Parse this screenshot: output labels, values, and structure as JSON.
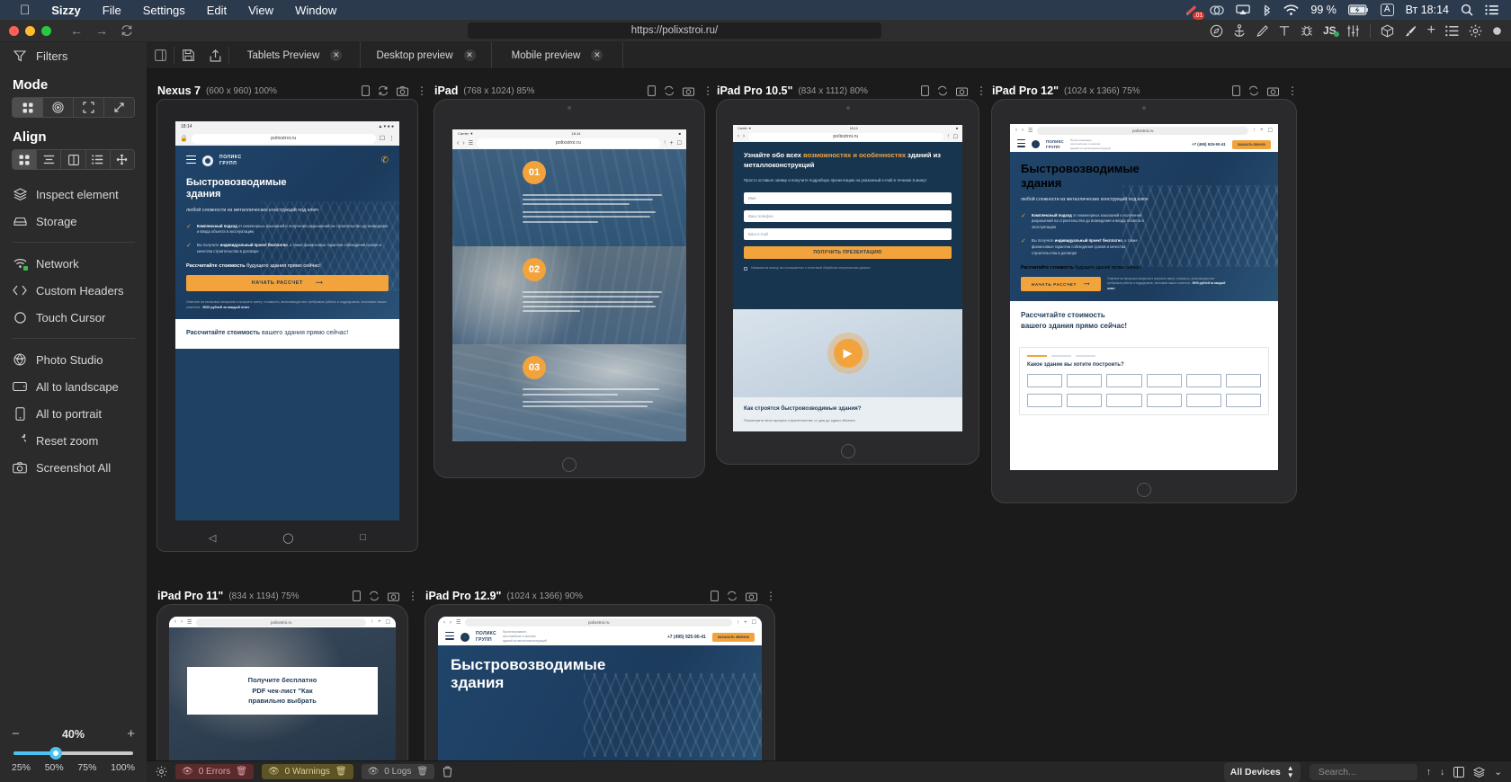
{
  "menubar": {
    "apple_icon": "apple-icon",
    "items": [
      {
        "label": "Sizzy",
        "bold": true
      },
      {
        "label": "File",
        "bold": false
      },
      {
        "label": "Settings",
        "bold": false
      },
      {
        "label": "Edit",
        "bold": false
      },
      {
        "label": "View",
        "bold": false
      },
      {
        "label": "Window",
        "bold": false
      }
    ],
    "tray": {
      "badge_count": ".01",
      "battery_percent": "99 %",
      "input_source": "A",
      "clock": "Вт 18:14",
      "icons": [
        "kite-icon",
        "creative-cloud-icon",
        "airplay-icon",
        "bluetooth-icon",
        "wifi-icon",
        "battery-charging-icon",
        "search-icon",
        "control-center-icon"
      ]
    }
  },
  "chrome": {
    "url": "https://polixstroi.ru/",
    "nav": {
      "back": "back-icon",
      "forward": "forward-icon",
      "reload": "reload-icon"
    },
    "right_icons": [
      "compass-icon",
      "anchor-icon",
      "pencil-icon",
      "text-icon",
      "bug-icon",
      "js-icon",
      "sliders-icon",
      "box-icon",
      "brush-icon",
      "plus-icon",
      "list-icon",
      "gear-icon",
      "dot-icon"
    ]
  },
  "sidebar": {
    "filters_label": "Filters",
    "mode_label": "Mode",
    "align_label": "Align",
    "mode_buttons": [
      {
        "name": "grid-mode",
        "glyph": "▞",
        "active": true
      },
      {
        "name": "focus-mode",
        "glyph": "◎",
        "active": false
      },
      {
        "name": "crop-mode",
        "glyph": "⛶",
        "active": false
      },
      {
        "name": "fullscreen-mode",
        "glyph": "⤢",
        "active": false
      }
    ],
    "align_buttons": [
      {
        "name": "align-grid",
        "glyph": "▞",
        "active": true
      },
      {
        "name": "align-rows",
        "glyph": "☰",
        "active": false
      },
      {
        "name": "align-columns",
        "glyph": "◫",
        "active": false
      },
      {
        "name": "align-list",
        "glyph": "⋮≡",
        "active": false
      },
      {
        "name": "align-free",
        "glyph": "✥",
        "active": false
      }
    ],
    "items": [
      {
        "label": "Inspect element",
        "icon": "layers-icon"
      },
      {
        "label": "Storage",
        "icon": "storage-icon"
      },
      {
        "label": "Network",
        "icon": "wifi-icon"
      },
      {
        "label": "Custom Headers",
        "icon": "code-icon"
      },
      {
        "label": "Touch Cursor",
        "icon": "circle-icon"
      },
      {
        "label": "Photo Studio",
        "icon": "aperture-icon"
      },
      {
        "label": "All to landscape",
        "icon": "landscape-icon"
      },
      {
        "label": "All to portrait",
        "icon": "portrait-icon"
      },
      {
        "label": "Reset zoom",
        "icon": "reset-icon"
      },
      {
        "label": "Screenshot All",
        "icon": "camera-icon"
      }
    ],
    "zoom": {
      "value": "40%",
      "minus": "−",
      "plus": "+",
      "fill_percent": 35,
      "ticks": [
        "25%",
        "50%",
        "75%",
        "100%"
      ]
    }
  },
  "tabbar": {
    "save_icon": "save-icon",
    "share_icon": "share-icon",
    "tabs": [
      {
        "label": "Tablets Preview",
        "closable": true,
        "active": true
      },
      {
        "label": "Desktop preview",
        "closable": true,
        "active": false
      },
      {
        "label": "Mobile preview",
        "closable": true,
        "active": false
      }
    ]
  },
  "devices": [
    {
      "name": "Nexus 7",
      "size": "(600 x 960) 100%",
      "zoom": "100%"
    },
    {
      "name": "iPad",
      "size": "(768 x 1024) 85%",
      "zoom": "85%"
    },
    {
      "name": "iPad Pro 10.5\"",
      "size": "(834 x 1112) 80%",
      "zoom": "80%"
    },
    {
      "name": "iPad Pro 12\"",
      "size": "(1024 x 1366) 75%",
      "zoom": "75%"
    },
    {
      "name": "iPad Pro 11\"",
      "size": "(834 x 1194) 75%",
      "zoom": "75%"
    },
    {
      "name": "iPad Pro 12.9\"",
      "size": "(1024 x 1366) 90%",
      "zoom": "90%"
    }
  ],
  "device_tools": [
    "rotate-device-icon",
    "reload-device-icon",
    "screenshot-device-icon",
    "more-options-icon"
  ],
  "site": {
    "url_short": "polixstroi.ru",
    "status_time": "18:14",
    "brand_line1": "ПОЛИКС",
    "brand_line2": "ГРУПП",
    "h1_line1": "Быстровозводимые",
    "h1_line2": "здания",
    "subtitle": "любой сложности из металлических конструкций под ключ",
    "bullet1_bold": "Комплексный подход",
    "bullet1_rest": " от инженерных изысканий и получения разрешений на строительство до возведения и ввода объекта в эксплуатацию",
    "bullet2_pre": "Вы получите ",
    "bullet2_bold": "индивидуальный проект бесплатно",
    "bullet2_rest": ", а также финансовые гарантии соблюдения сроков и качества строительства в договоре",
    "calc_bold": "Рассчитайте стоимость",
    "calc_rest": " будущего здания прямо сейчас!",
    "cta_label": "НАЧАТЬ РАССЧЕТ",
    "cta_arrow": "⟶",
    "fineprint_pre": "Ответьте на несколько вопросов и получите смету: стоимость, включающую все требуемые работы и подрядчиков, экономию наших клиентов - ",
    "fineprint_bold": "5000 рублей за каждый ответ",
    "whiteband_bold": "Рассчитайте стоимость",
    "whiteband_rest": " вашего здания прямо сейчас!",
    "phone": "+7 (495) 925-90-41",
    "header_button": "ЗАКАЗАТЬ ЗВОНОК",
    "numbered_sections": [
      {
        "number": "01"
      },
      {
        "number": "02"
      },
      {
        "number": "03"
      }
    ],
    "form": {
      "title_pre": "Узнайте обо всех ",
      "title_accent": "возможностях и особенностях",
      "title_post": " зданий из металлоконструкций",
      "paragraph": "Просто оставьте заявку и получите подробную презентацию на указанный e-mail в течение 5 минут",
      "fields": [
        "Имя",
        "Ваш телефон",
        "Ваш e-mail"
      ],
      "submit": "ПОЛУЧИТЬ ПРЕЗЕНТАЦИЮ",
      "consent": "Нажимая на кнопку, вы соглашаетесь с политикой обработки персональных данных"
    },
    "video": {
      "title": "Как строятся быстровозводимые здания?",
      "subtitle": "Посмотрите весь процесс строительства: от дня до сдачи объекта",
      "play_icon": "play-icon"
    },
    "builder": {
      "question": "Какое здание вы хотите построить?"
    },
    "pdf": {
      "line1": "Получите бесплатно",
      "line2": "PDF чек-лист \"Как",
      "line3": "правильно выбрать"
    }
  },
  "statusbar": {
    "gear_icon": "gear-icon",
    "errors": "0  Errors",
    "warnings": "0  Warnings",
    "logs": "0  Logs",
    "trash_icon": "trash-icon",
    "device_filter": "All Devices",
    "search_placeholder": "Search...",
    "right_icons": [
      "arrow-up-icon",
      "arrow-down-icon",
      "split-icon",
      "layers-icon",
      "chevron-down-icon"
    ]
  },
  "colors": {
    "accent": "#f2a33c",
    "brand_dark": "#1f4263",
    "slider": "#4cc2f1",
    "menubar": "#2b3a4d"
  }
}
